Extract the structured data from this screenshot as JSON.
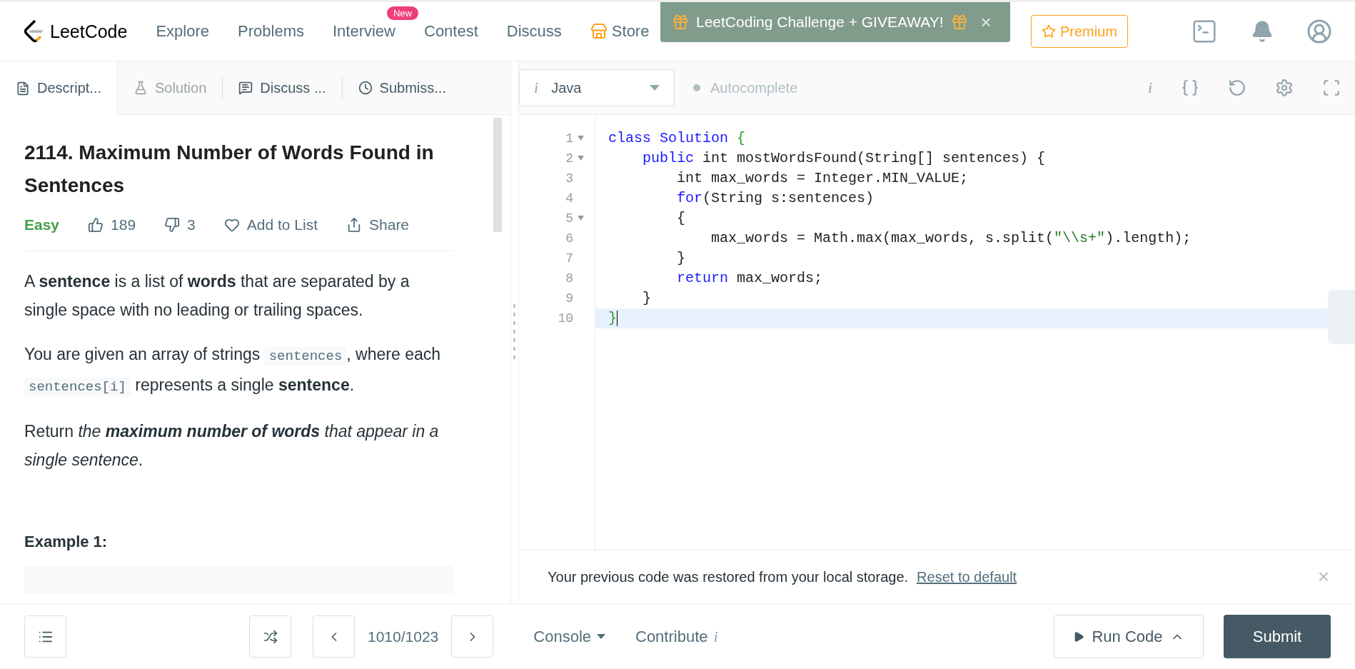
{
  "header": {
    "logo": "LeetCode",
    "nav": [
      {
        "label": "Explore"
      },
      {
        "label": "Problems"
      },
      {
        "label": "Interview",
        "badge": "New"
      },
      {
        "label": "Contest"
      },
      {
        "label": "Discuss"
      },
      {
        "label": "Store"
      }
    ],
    "banner": {
      "text": "LeetCoding Challenge + GIVEAWAY!",
      "close": "×"
    },
    "premium": "Premium"
  },
  "tabs": [
    {
      "label": "Descript...",
      "selected": true,
      "disabled": false
    },
    {
      "label": "Solution",
      "selected": false,
      "disabled": true
    },
    {
      "label": "Discuss ...",
      "selected": false,
      "disabled": false
    },
    {
      "label": "Submiss...",
      "selected": false,
      "disabled": false
    }
  ],
  "problem": {
    "title": "2114. Maximum Number of Words Found in Sentences",
    "difficulty": "Easy",
    "likes": "189",
    "dislikes": "3",
    "add_to_list": "Add to List",
    "share": "Share",
    "paragraphs": [
      [
        {
          "kind": "text",
          "s": "A "
        },
        {
          "kind": "bold",
          "s": "sentence"
        },
        {
          "kind": "text",
          "s": " is a list of "
        },
        {
          "kind": "bold",
          "s": "words"
        },
        {
          "kind": "text",
          "s": " that are separated by a single space with no leading or trailing spaces."
        }
      ],
      [
        {
          "kind": "text",
          "s": "You are given an array of strings "
        },
        {
          "kind": "code",
          "s": "sentences"
        },
        {
          "kind": "text",
          "s": ", where each "
        },
        {
          "kind": "code",
          "s": "sentences[i]"
        },
        {
          "kind": "text",
          "s": " represents a single "
        },
        {
          "kind": "bold",
          "s": "sentence"
        },
        {
          "kind": "text",
          "s": "."
        }
      ],
      [
        {
          "kind": "text",
          "s": "Return "
        },
        {
          "kind": "italic",
          "s": "the "
        },
        {
          "kind": "bolditalic",
          "s": "maximum number of words"
        },
        {
          "kind": "italic",
          "s": " that appear in a single sentence"
        },
        {
          "kind": "text",
          "s": "."
        }
      ]
    ],
    "example_heading": "Example 1:"
  },
  "editor": {
    "language_info": "i",
    "language": "Java",
    "autocomplete": {
      "label": "Autocomplete",
      "on": false
    },
    "toolbar_info": "i",
    "lines": [
      {
        "number": "1",
        "foldable": true,
        "selected": false,
        "tokens": [
          {
            "kind": "keyword",
            "s": "class Solution "
          },
          {
            "kind": "bracket",
            "s": "{"
          }
        ]
      },
      {
        "number": "2",
        "foldable": true,
        "selected": false,
        "tokens": [
          {
            "kind": "keyword",
            "s": "    public"
          },
          {
            "kind": "plain",
            "s": " int mostWordsFound(String[] sentences) {"
          }
        ]
      },
      {
        "number": "3",
        "foldable": false,
        "selected": false,
        "tokens": [
          {
            "kind": "plain",
            "s": "        int max_words = Integer.MIN_VALUE;"
          }
        ]
      },
      {
        "number": "4",
        "foldable": false,
        "selected": false,
        "tokens": [
          {
            "kind": "keyword",
            "s": "        for"
          },
          {
            "kind": "plain",
            "s": "(String s:sentences)"
          }
        ]
      },
      {
        "number": "5",
        "foldable": true,
        "selected": false,
        "tokens": [
          {
            "kind": "plain",
            "s": "        {"
          }
        ]
      },
      {
        "number": "6",
        "foldable": false,
        "selected": false,
        "tokens": [
          {
            "kind": "plain",
            "s": "            max_words = Math.max(max_words, s.split("
          },
          {
            "kind": "string",
            "s": "\"\\\\s+\""
          },
          {
            "kind": "plain",
            "s": ").length);"
          }
        ]
      },
      {
        "number": "7",
        "foldable": false,
        "selected": false,
        "tokens": [
          {
            "kind": "plain",
            "s": "        }"
          }
        ]
      },
      {
        "number": "8",
        "foldable": false,
        "selected": false,
        "tokens": [
          {
            "kind": "keyword",
            "s": "        return"
          },
          {
            "kind": "plain",
            "s": " max_words;"
          }
        ]
      },
      {
        "number": "9",
        "foldable": false,
        "selected": false,
        "tokens": [
          {
            "kind": "plain",
            "s": "    }"
          }
        ]
      },
      {
        "number": "10",
        "foldable": false,
        "selected": true,
        "tokens": [
          {
            "kind": "bracket",
            "s": "}"
          }
        ]
      }
    ],
    "notice": {
      "text": "Your previous code was restored from your local storage.",
      "link": "Reset to default",
      "close": "×"
    }
  },
  "footer": {
    "pager": "1010/1023",
    "console": "Console",
    "contribute": "Contribute",
    "contribute_info": "i",
    "run": "Run Code",
    "submit": "Submit"
  }
}
